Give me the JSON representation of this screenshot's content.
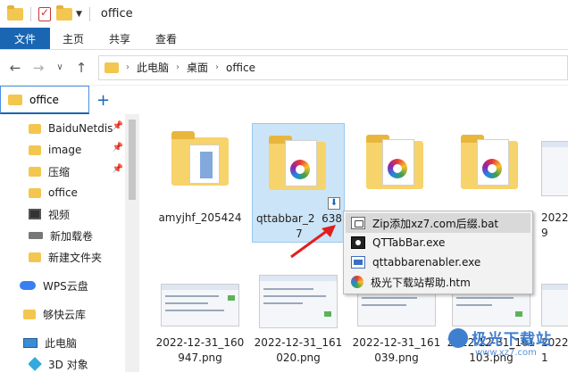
{
  "window": {
    "title": "office"
  },
  "ribbon": {
    "tabs": [
      "文件",
      "主页",
      "共享",
      "查看"
    ]
  },
  "address": {
    "parts": [
      "此电脑",
      "桌面",
      "office"
    ]
  },
  "folder_tab": {
    "label": "office"
  },
  "sidebar": {
    "items": [
      {
        "label": "BaiduNetdis",
        "icon": "folder-icon",
        "pinned": true
      },
      {
        "label": "image",
        "icon": "folder-icon",
        "pinned": true
      },
      {
        "label": "压缩",
        "icon": "folder-icon",
        "pinned": true
      },
      {
        "label": "office",
        "icon": "folder-icon",
        "pinned": false
      },
      {
        "label": "视频",
        "icon": "video-icon",
        "pinned": false
      },
      {
        "label": "新加载卷",
        "icon": "drive-icon",
        "pinned": false
      },
      {
        "label": "新建文件夹",
        "icon": "folder-icon",
        "pinned": false
      },
      {
        "label": "WPS云盘",
        "icon": "cloud-icon",
        "pinned": false
      },
      {
        "label": "够快云库",
        "icon": "folder-icon",
        "pinned": false
      },
      {
        "label": "此电脑",
        "icon": "pc-icon",
        "pinned": false
      },
      {
        "label": "3D 对象",
        "icon": "3d-object-icon",
        "pinned": false
      }
    ]
  },
  "files": {
    "row1": [
      {
        "name": "amyjhf_205424"
      },
      {
        "name": "qttabbar_2  638",
        "name2": "7"
      },
      {
        "name": ""
      },
      {
        "name": ""
      },
      {
        "name": "2022",
        "name2": "9"
      }
    ],
    "row2": [
      {
        "name": "2022-12-31_160",
        "name2": "947.png"
      },
      {
        "name": "2022-12-31_161",
        "name2": "020.png"
      },
      {
        "name": "2022-12-31_161",
        "name2": "039.png"
      },
      {
        "name": "2022-12-31_161",
        "name2": "103.png"
      },
      {
        "name": "2022",
        "name2": "1"
      }
    ]
  },
  "popup": {
    "items": [
      {
        "label": "Zip添加xz7.com后缀.bat",
        "icon": "bat-icon"
      },
      {
        "label": "QTTabBar.exe",
        "icon": "exe-icon"
      },
      {
        "label": "qttabbarenabler.exe",
        "icon": "exe-icon"
      },
      {
        "label": "极光下载站帮助.htm",
        "icon": "htm-icon"
      }
    ]
  },
  "watermark": {
    "text": "极光下载站",
    "sub": "www.xz7.com"
  }
}
